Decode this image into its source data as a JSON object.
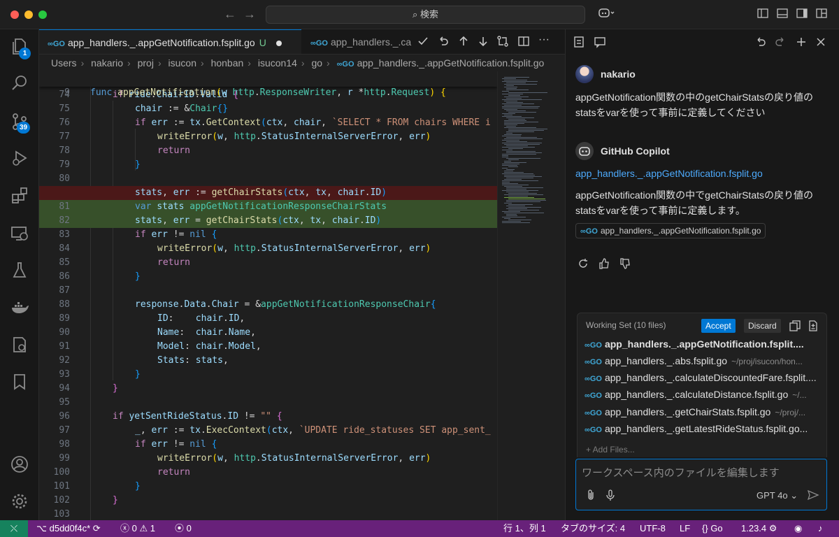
{
  "titlebar": {
    "search_text": "検索",
    "back_icon": "arrow-left-icon",
    "forward_icon": "arrow-right-icon"
  },
  "activity_bar": {
    "items": [
      {
        "name": "explorer",
        "icon": "files-icon",
        "badge": "1"
      },
      {
        "name": "search",
        "icon": "search-icon",
        "badge": ""
      },
      {
        "name": "source-control",
        "icon": "source-control-icon",
        "badge": "39"
      },
      {
        "name": "run-debug",
        "icon": "debug-icon",
        "badge": ""
      },
      {
        "name": "extensions",
        "icon": "extensions-icon",
        "badge": ""
      },
      {
        "name": "remote-explorer",
        "icon": "remote-icon",
        "badge": ""
      },
      {
        "name": "testing",
        "icon": "flask-icon",
        "badge": ""
      },
      {
        "name": "docker",
        "icon": "docker-icon",
        "badge": ""
      },
      {
        "name": "containers",
        "icon": "container-icon",
        "badge": ""
      },
      {
        "name": "bookmarks",
        "icon": "bookmark-icon",
        "badge": ""
      }
    ],
    "bottom": [
      "account-icon",
      "settings-gear-icon"
    ]
  },
  "tabs": [
    {
      "label": "app_handlers._.appGetNotification.fsplit.go",
      "status": "U",
      "active": true
    },
    {
      "label": "app_handlers._.ca",
      "status": "",
      "active": false
    }
  ],
  "breadcrumb": [
    "Users",
    "nakario",
    "proj",
    "isucon",
    "honban",
    "isucon14",
    "go",
    "app_handlers._.appGetNotification.fsplit.go"
  ],
  "editor": {
    "sticky_line_number": "9",
    "accent": "#0078d4",
    "removed_color": "#4b1818",
    "added_color": "#37502a"
  },
  "chat": {
    "user": {
      "name": "nakario",
      "message": "appGetNotification関数の中のgetChairStatsの戻り値のstatsをvarを使って事前に定義してください"
    },
    "assistant": {
      "name": "GitHub Copilot",
      "link": "app_handlers._.appGetNotification.fsplit.go",
      "message": "appGetNotification関数の中でgetChairStatsの戻り値のstatsをvarを使って事前に定義します。",
      "chip": "app_handlers._.appGetNotification.fsplit.go"
    },
    "working_set": {
      "title": "Working Set (10 files)",
      "accept_label": "Accept",
      "discard_label": "Discard",
      "files": [
        {
          "name": "app_handlers._.appGetNotification.fsplit....",
          "path": ""
        },
        {
          "name": "app_handlers._.abs.fsplit.go",
          "path": "~/proj/isucon/hon..."
        },
        {
          "name": "app_handlers._.calculateDiscountedFare.fsplit....",
          "path": ""
        },
        {
          "name": "app_handlers._.calculateDistance.fsplit.go",
          "path": "~/..."
        },
        {
          "name": "app_handlers._.getChairStats.fsplit.go",
          "path": "~/proj/..."
        },
        {
          "name": "app_handlers._.getLatestRideStatus.fsplit.go...",
          "path": ""
        }
      ],
      "add_files": "+ Add Files..."
    },
    "input_placeholder": "ワークスペース内のファイルを編集します",
    "model": "GPT 4o"
  },
  "statusbar": {
    "branch": "d5dd0f4c*",
    "errors": "0",
    "warnings": "1",
    "ports": "0",
    "position": "行 1、列 1",
    "tab_size": "タブのサイズ: 4",
    "encoding": "UTF-8",
    "eol": "LF",
    "language": "Go",
    "go_version": "1.23.4",
    "color": "#68217a",
    "remote_color": "#16825d"
  }
}
